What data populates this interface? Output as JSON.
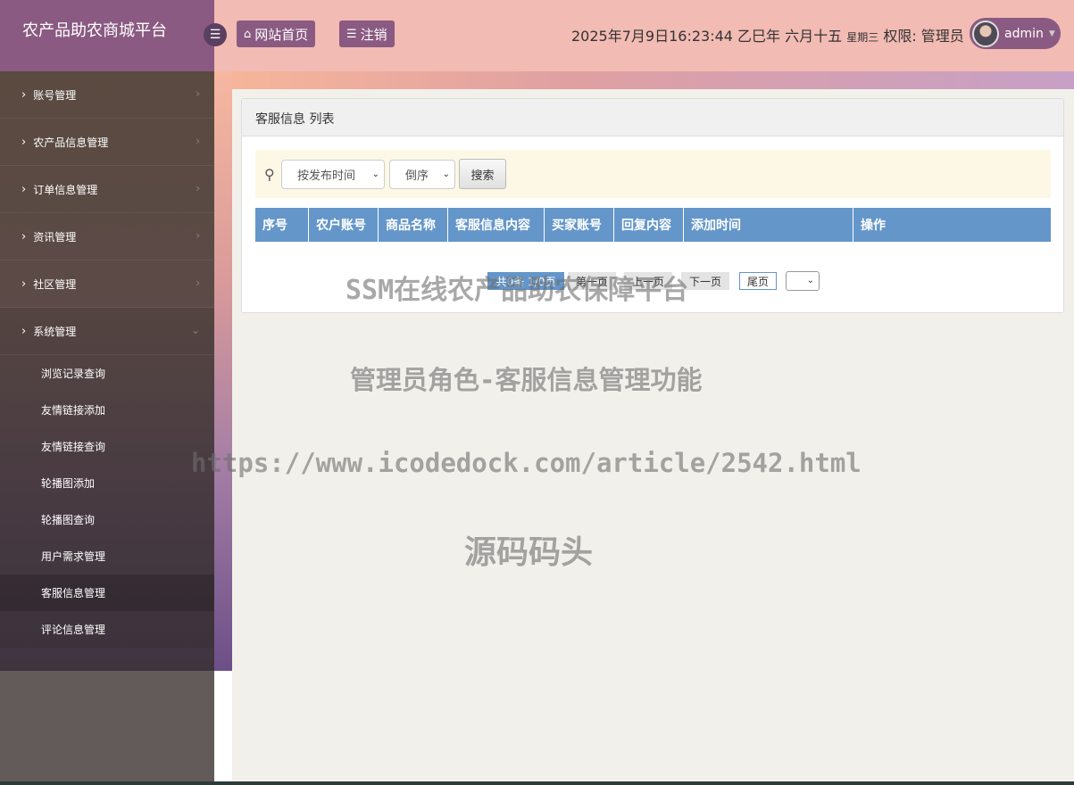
{
  "brand": {
    "title": "农产品助农商城平台"
  },
  "header": {
    "home_label": "网站首页",
    "logout_label": "注销",
    "datetime": "2025年7月9日16:23:44 乙巳年 六月十五",
    "weekday": "星期三",
    "role_text": "权限: 管理员",
    "username": "admin"
  },
  "sidebar": {
    "items": [
      {
        "label": "账号管理"
      },
      {
        "label": "农产品信息管理"
      },
      {
        "label": "订单信息管理"
      },
      {
        "label": "资讯管理"
      },
      {
        "label": "社区管理"
      },
      {
        "label": "系统管理"
      }
    ],
    "subitems": [
      {
        "label": "浏览记录查询"
      },
      {
        "label": "友情链接添加"
      },
      {
        "label": "友情链接查询"
      },
      {
        "label": "轮播图添加"
      },
      {
        "label": "轮播图查询"
      },
      {
        "label": "用户需求管理"
      },
      {
        "label": "客服信息管理"
      },
      {
        "label": "评论信息管理"
      }
    ]
  },
  "panel": {
    "title": "客服信息 列表"
  },
  "search": {
    "sort_field": "按发布时间",
    "sort_order": "倒序",
    "button_label": "搜索"
  },
  "table": {
    "columns": [
      "序号",
      "农户账号",
      "商品名称",
      "客服信息内容",
      "买家账号",
      "回复内容",
      "添加时间",
      "操作"
    ]
  },
  "pager": {
    "info": "共0条  1/0页",
    "first": "第一页",
    "prev": "上一页",
    "next": "下一页",
    "last": "尾页"
  },
  "watermarks": [
    "SSM在线农产品助农保障平台",
    "管理员角色-客服信息管理功能",
    "https://www.icodedock.com/article/2542.html",
    "源码码头"
  ]
}
